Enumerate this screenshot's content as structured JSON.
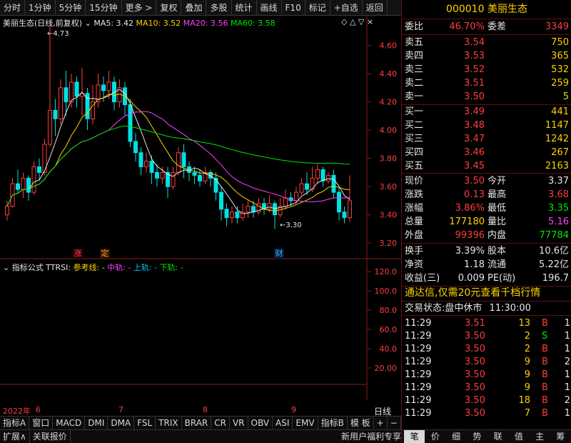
{
  "toolbar": {
    "items": [
      "分时",
      "1分钟",
      "5分钟",
      "15分钟",
      "更多 >",
      "复权",
      "叠加",
      "多股",
      "统计",
      "画线",
      "F10",
      "标记",
      "+自选",
      "返回"
    ]
  },
  "chart_title": {
    "name": "美丽生态(日线,前复权)",
    "ma5": "MA5: 3.42",
    "ma10": "MA10: 3.52",
    "ma20": "MA20: 3.56",
    "ma60": "MA60: 3.58"
  },
  "price_axis": [
    "4.60",
    "4.40",
    "4.20",
    "4.00",
    "3.80",
    "3.60",
    "3.40",
    "3.20"
  ],
  "annotations": {
    "high": "4.73",
    "low": "3.30",
    "mark1": "涨",
    "mark2": "定",
    "mark3": "财"
  },
  "indicator": {
    "label": "指标公式",
    "name": "TTRSI:",
    "ref": "参考线: -",
    "mid": "中轨: -",
    "up": "上轨: -",
    "down": "下轨: -",
    "axis": [
      "120.0",
      "100.0",
      "80.0",
      "60.0",
      "40.0",
      "20.00"
    ]
  },
  "date_axis": {
    "year": "2022年",
    "m6": "6",
    "m7": "7",
    "m8": "8",
    "m9": "9",
    "period": "日线"
  },
  "indicator_tabs": [
    "指标A",
    "窗口",
    "MACD",
    "DMI",
    "DMA",
    "FSL",
    "TRIX",
    "BRAR",
    "CR",
    "VR",
    "OBV",
    "ASI",
    "EMV",
    "指标B",
    "模 板",
    "+",
    "−"
  ],
  "bottom_bar": {
    "expand": "扩展∧",
    "link": "关联报价",
    "promo": "新用户福利专享"
  },
  "bottom_tabs": [
    "笔",
    "价",
    "细",
    "势",
    "联",
    "值",
    "主",
    "筹"
  ],
  "stock": {
    "code": "000010",
    "name": "美丽生态"
  },
  "weibi": {
    "label1": "委比",
    "value1": "46.70%",
    "label2": "委差",
    "value2": "3349"
  },
  "asks": [
    {
      "label": "卖五",
      "price": "3.54",
      "vol": "750"
    },
    {
      "label": "卖四",
      "price": "3.53",
      "vol": "365"
    },
    {
      "label": "卖三",
      "price": "3.52",
      "vol": "532"
    },
    {
      "label": "卖二",
      "price": "3.51",
      "vol": "259"
    },
    {
      "label": "卖一",
      "price": "3.50",
      "vol": "5"
    }
  ],
  "bids": [
    {
      "label": "买一",
      "price": "3.49",
      "vol": "441"
    },
    {
      "label": "买二",
      "price": "3.48",
      "vol": "1147"
    },
    {
      "label": "买三",
      "price": "3.47",
      "vol": "1242"
    },
    {
      "label": "买四",
      "price": "3.46",
      "vol": "267"
    },
    {
      "label": "买五",
      "price": "3.45",
      "vol": "2163"
    }
  ],
  "quote": [
    {
      "l1": "现价",
      "v1": "3.50",
      "c1": "red",
      "l2": "今开",
      "v2": "3.37",
      "c2": "wht"
    },
    {
      "l1": "涨跌",
      "v1": "0.13",
      "c1": "red",
      "l2": "最高",
      "v2": "3.68",
      "c2": "red"
    },
    {
      "l1": "涨幅",
      "v1": "3.86%",
      "c1": "red",
      "l2": "最低",
      "v2": "3.35",
      "c2": "grn"
    },
    {
      "l1": "总量",
      "v1": "177180",
      "c1": "yel",
      "l2": "量比",
      "v2": "5.16",
      "c2": "mag"
    },
    {
      "l1": "外盘",
      "v1": "99396",
      "c1": "red",
      "l2": "内盘",
      "v2": "77784",
      "c2": "grn"
    }
  ],
  "stats": [
    {
      "l1": "换手",
      "v1": "3.39%",
      "l2": "股本",
      "v2": "10.6亿"
    },
    {
      "l1": "净资",
      "v1": "1.18",
      "l2": "流通",
      "v2": "5.22亿"
    },
    {
      "l1": "收益(三)",
      "v1": "0.009",
      "l2": "PE(动)",
      "v2": "196.7"
    }
  ],
  "promo_line": "通达信,仅需20元查看千档行情",
  "trade_status": {
    "label": "交易状态:",
    "value": "盘中休市",
    "time": "11:30:00"
  },
  "ticks": [
    {
      "time": "11:29",
      "price": "3.51",
      "vol": "13",
      "bs": "B",
      "n": "1"
    },
    {
      "time": "11:29",
      "price": "3.50",
      "vol": "2",
      "bs": "S",
      "n": "1"
    },
    {
      "time": "11:29",
      "price": "3.50",
      "vol": "2",
      "bs": "B",
      "n": "1"
    },
    {
      "time": "11:29",
      "price": "3.50",
      "vol": "9",
      "bs": "B",
      "n": "2"
    },
    {
      "time": "11:29",
      "price": "3.50",
      "vol": "9",
      "bs": "B",
      "n": "1"
    },
    {
      "time": "11:29",
      "price": "3.50",
      "vol": "9",
      "bs": "B",
      "n": "1"
    },
    {
      "time": "11:29",
      "price": "3.50",
      "vol": "18",
      "bs": "B",
      "n": "2"
    },
    {
      "time": "11:29",
      "price": "3.50",
      "vol": "7",
      "bs": "B",
      "n": "1"
    }
  ],
  "chart_data": {
    "type": "candlestick",
    "ylim": [
      3.12,
      4.78
    ],
    "candles": [
      [
        3.4,
        3.46,
        3.36,
        3.5
      ],
      [
        3.46,
        3.62,
        3.45,
        3.66
      ],
      [
        3.62,
        3.58,
        3.55,
        3.72
      ],
      [
        3.58,
        3.66,
        3.52,
        3.7
      ],
      [
        3.66,
        3.56,
        3.5,
        3.68
      ],
      [
        3.56,
        3.74,
        3.54,
        3.78
      ],
      [
        3.74,
        3.7,
        3.64,
        3.8
      ],
      [
        3.7,
        3.9,
        3.68,
        3.94
      ],
      [
        3.9,
        4.14,
        3.88,
        4.73
      ],
      [
        4.14,
        4.08,
        3.96,
        4.22
      ],
      [
        4.08,
        4.3,
        4.04,
        4.36
      ],
      [
        4.3,
        4.2,
        4.1,
        4.42
      ],
      [
        4.2,
        4.34,
        4.16,
        4.4
      ],
      [
        4.34,
        4.24,
        4.16,
        4.38
      ],
      [
        4.24,
        4.26,
        4.1,
        4.44
      ],
      [
        4.26,
        4.08,
        4.0,
        4.3
      ],
      [
        4.08,
        4.2,
        4.04,
        4.32
      ],
      [
        4.2,
        4.32,
        4.16,
        4.4
      ],
      [
        4.32,
        4.28,
        4.2,
        4.38
      ],
      [
        4.28,
        4.34,
        4.22,
        4.42
      ],
      [
        4.34,
        4.2,
        4.14,
        4.38
      ],
      [
        4.2,
        4.3,
        4.16,
        4.36
      ],
      [
        4.3,
        4.18,
        4.1,
        4.34
      ],
      [
        4.18,
        3.92,
        3.88,
        4.22
      ],
      [
        3.92,
        3.84,
        3.78,
        3.98
      ],
      [
        3.84,
        3.74,
        3.68,
        3.88
      ],
      [
        3.74,
        3.78,
        3.7,
        3.84
      ],
      [
        3.78,
        3.7,
        3.62,
        3.82
      ],
      [
        3.7,
        3.66,
        3.6,
        3.76
      ],
      [
        3.66,
        3.7,
        3.62,
        3.74
      ],
      [
        3.7,
        3.6,
        3.52,
        3.74
      ],
      [
        3.6,
        3.7,
        3.58,
        3.74
      ],
      [
        3.7,
        3.84,
        3.68,
        3.88
      ],
      [
        3.84,
        3.74,
        3.66,
        3.9
      ],
      [
        3.74,
        3.7,
        3.64,
        3.78
      ],
      [
        3.7,
        3.68,
        3.62,
        3.74
      ],
      [
        3.68,
        3.64,
        3.6,
        3.72
      ],
      [
        3.64,
        3.7,
        3.62,
        3.74
      ],
      [
        3.7,
        3.66,
        3.6,
        3.72
      ],
      [
        3.66,
        3.56,
        3.5,
        3.7
      ],
      [
        3.56,
        3.44,
        3.36,
        3.6
      ],
      [
        3.44,
        3.38,
        3.32,
        3.48
      ],
      [
        3.38,
        3.42,
        3.34,
        3.46
      ],
      [
        3.42,
        3.38,
        3.34,
        3.46
      ],
      [
        3.38,
        3.42,
        3.36,
        3.48
      ],
      [
        3.42,
        3.46,
        3.38,
        3.5
      ],
      [
        3.46,
        3.42,
        3.38,
        3.5
      ],
      [
        3.42,
        3.48,
        3.4,
        3.52
      ],
      [
        3.48,
        3.44,
        3.4,
        3.52
      ],
      [
        3.44,
        3.48,
        3.42,
        3.54
      ],
      [
        3.48,
        3.4,
        3.3,
        3.5
      ],
      [
        3.4,
        3.46,
        3.38,
        3.52
      ],
      [
        3.46,
        3.52,
        3.44,
        3.58
      ],
      [
        3.52,
        3.5,
        3.46,
        3.56
      ],
      [
        3.5,
        3.56,
        3.48,
        3.6
      ],
      [
        3.56,
        3.62,
        3.54,
        3.66
      ],
      [
        3.62,
        3.58,
        3.54,
        3.7
      ],
      [
        3.58,
        3.66,
        3.56,
        3.74
      ],
      [
        3.66,
        3.72,
        3.62,
        3.76
      ],
      [
        3.72,
        3.64,
        3.6,
        3.74
      ],
      [
        3.64,
        3.68,
        3.62,
        3.7
      ],
      [
        3.68,
        3.56,
        3.52,
        3.72
      ],
      [
        3.56,
        3.42,
        3.36,
        3.6
      ],
      [
        3.42,
        3.38,
        3.34,
        3.46
      ],
      [
        3.38,
        3.5,
        3.35,
        3.68
      ]
    ]
  }
}
